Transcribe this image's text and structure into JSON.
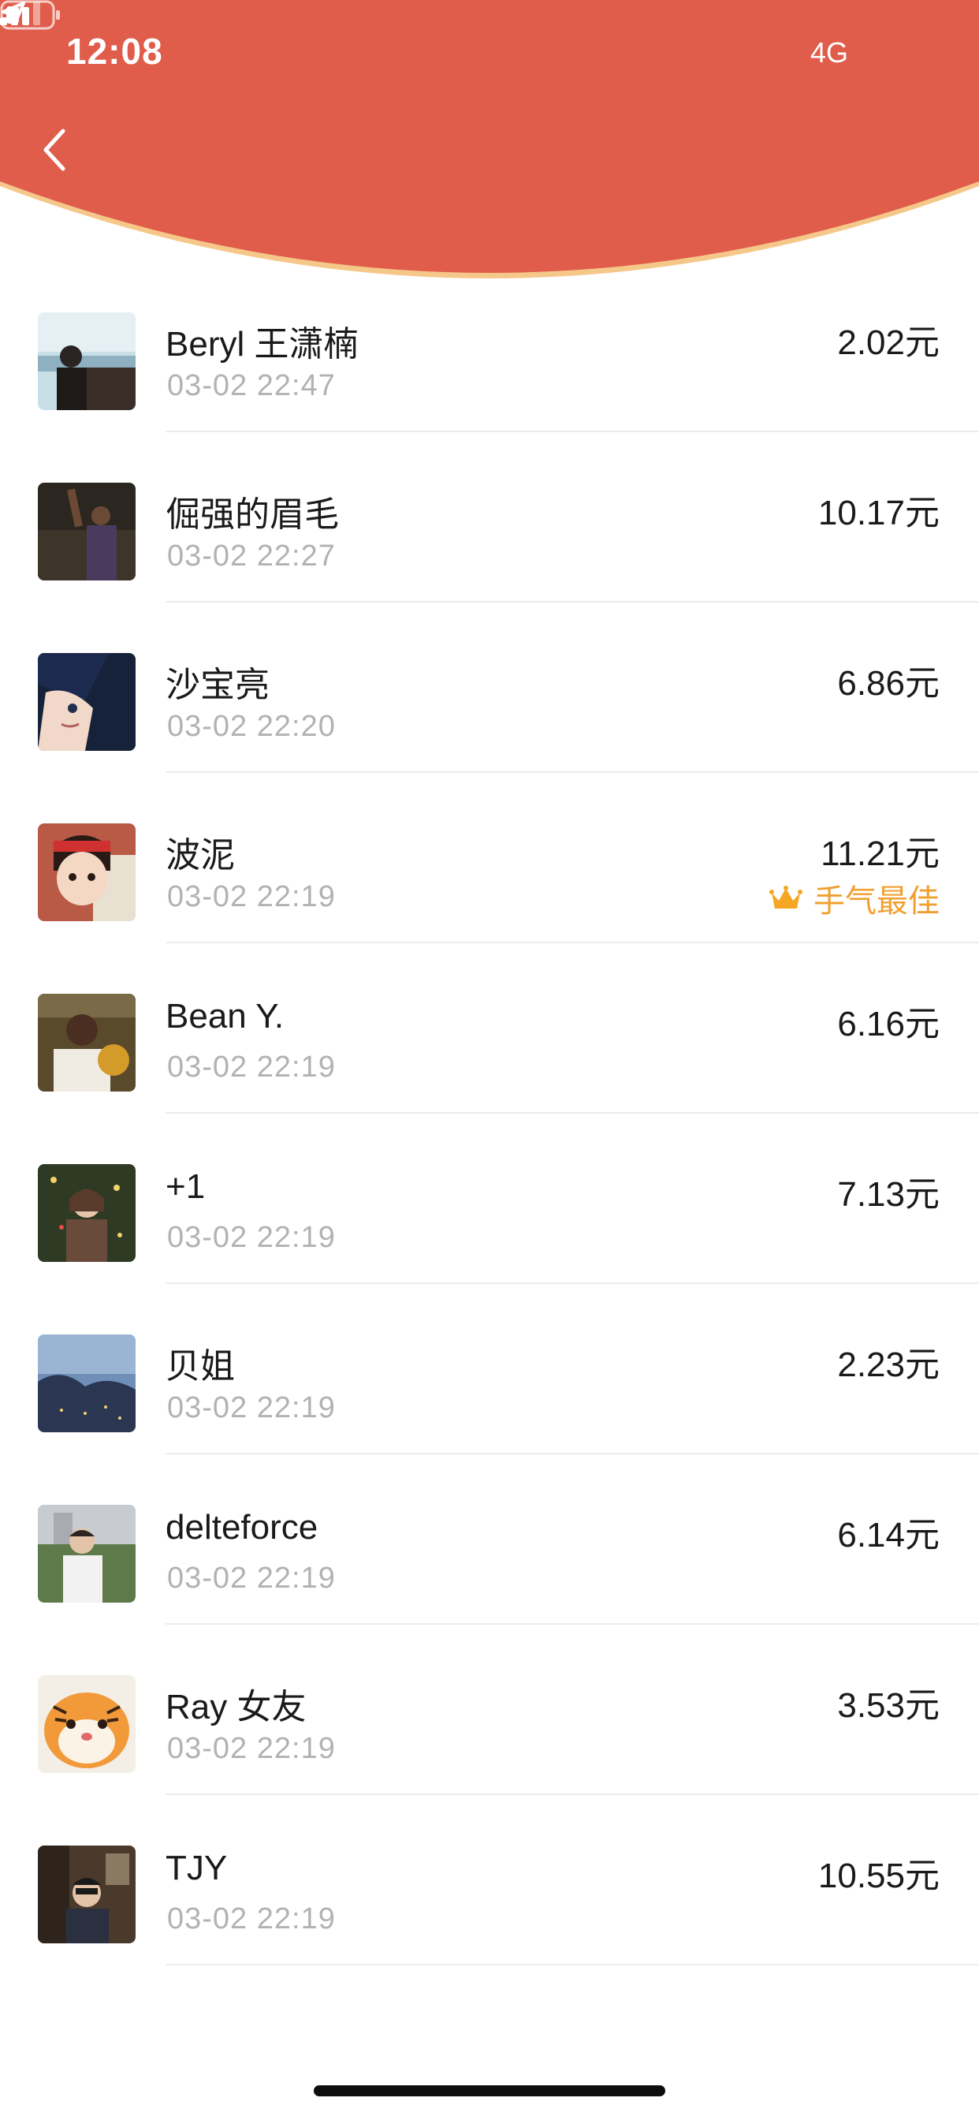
{
  "status_bar": {
    "time": "12:08",
    "network": "4G",
    "icons": [
      "location-arrow-icon",
      "signal-icon",
      "battery-icon"
    ]
  },
  "header": {
    "back_icon": "chevron-left-icon",
    "color": "#E05D4B",
    "edge_color": "#F5C88A"
  },
  "records": [
    {
      "name": "Beryl 王潇楠",
      "time": "03-02 22:47",
      "amount": "2.02元",
      "best": false
    },
    {
      "name": "倔强的眉毛",
      "time": "03-02 22:27",
      "amount": "10.17元",
      "best": false
    },
    {
      "name": "沙宝亮",
      "time": "03-02 22:20",
      "amount": "6.86元",
      "best": false
    },
    {
      "name": "波泥",
      "time": "03-02 22:19",
      "amount": "11.21元",
      "best": true
    },
    {
      "name": "Bean Y.",
      "time": "03-02 22:19",
      "amount": "6.16元",
      "best": false
    },
    {
      "name": "+1",
      "time": "03-02 22:19",
      "amount": "7.13元",
      "best": false
    },
    {
      "name": "贝姐",
      "time": "03-02 22:19",
      "amount": "2.23元",
      "best": false
    },
    {
      "name": "delteforce",
      "time": "03-02 22:19",
      "amount": "6.14元",
      "best": false
    },
    {
      "name": "Ray 女友",
      "time": "03-02 22:19",
      "amount": "3.53元",
      "best": false
    },
    {
      "name": "TJY",
      "time": "03-02 22:19",
      "amount": "10.55元",
      "best": false
    }
  ],
  "best_label": "手气最佳",
  "colors": {
    "accent": "#E05D4B",
    "best": "#F0A030",
    "secondary_text": "#B2B2B2"
  }
}
